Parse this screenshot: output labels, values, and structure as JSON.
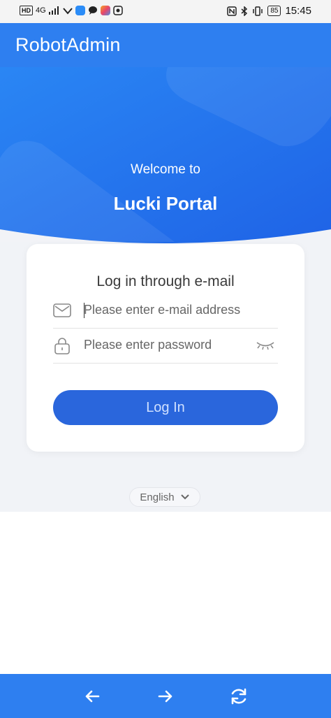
{
  "status_bar": {
    "network_hd": "HD",
    "network_type": "4G",
    "battery": "85",
    "time": "15:45"
  },
  "app_bar": {
    "title": "RobotAdmin"
  },
  "hero": {
    "welcome": "Welcome to",
    "portal_name": "Lucki Portal"
  },
  "login_card": {
    "title": "Log in through e-mail",
    "email_placeholder": "Please enter e-mail address",
    "password_placeholder": "Please enter password",
    "login_button": "Log In"
  },
  "language": {
    "selected": "English"
  },
  "colors": {
    "primary": "#2e7ff0",
    "button": "#2a66dc",
    "background": "#f1f3f7"
  },
  "icons": {
    "email": "envelope-icon",
    "password": "lock-icon",
    "visibility": "eye-closed-icon",
    "language": "chevron-down-icon",
    "back": "arrow-left-icon",
    "forward": "arrow-right-icon",
    "refresh": "refresh-icon"
  }
}
